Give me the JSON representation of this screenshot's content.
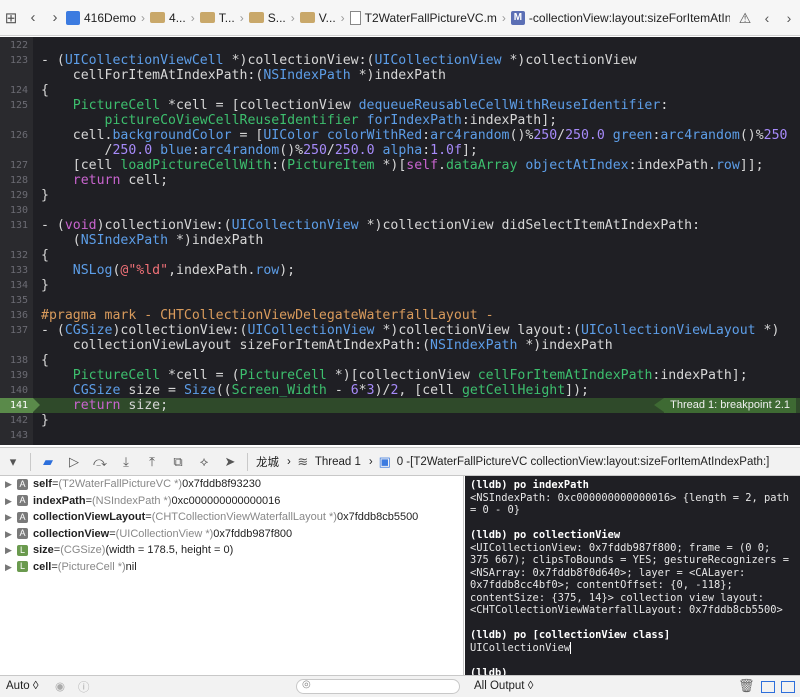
{
  "jumpbar": {
    "items": [
      "416Demo",
      "4...",
      "T...",
      "S...",
      "V...",
      "T2WaterFallPictureVC.m",
      "-collectionView:layout:sizeForItemAtIndexPath:"
    ]
  },
  "editor": {
    "lines": [
      {
        "n": "122",
        "html": ""
      },
      {
        "n": "123",
        "html": "<span class=\"p\">- (</span><span class=\"t\">UICollectionViewCell</span><span class=\"p\"> *)collectionView:(</span><span class=\"t\">UICollectionView</span><span class=\"p\"> *)collectionView</span>"
      },
      {
        "n": "",
        "html": "<span class=\"p\">    cellForItemAtIndexPath:(</span><span class=\"t\">NSIndexPath</span><span class=\"p\"> *)indexPath</span>"
      },
      {
        "n": "124",
        "html": "<span class=\"p\">{</span>"
      },
      {
        "n": "125",
        "html": "<span class=\"p\">    </span><span class=\"g\">PictureCell</span><span class=\"p\"> *cell = [collectionView </span><span class=\"m\">dequeueReusableCellWithReuseIdentifier</span><span class=\"p\">:</span>"
      },
      {
        "n": "",
        "html": "<span class=\"p\">        </span><span class=\"g\">pictureCoViewCellReuseIdentifier</span><span class=\"p\"> </span><span class=\"m\">forIndexPath</span><span class=\"p\">:indexPath];</span>"
      },
      {
        "n": "126",
        "html": "<span class=\"p\">    cell.</span><span class=\"m\">backgroundColor</span><span class=\"p\"> = [</span><span class=\"t\">UIColor</span><span class=\"p\"> </span><span class=\"m\">colorWithRed</span><span class=\"p\">:</span><span class=\"m\">arc4random</span><span class=\"p\">()%</span><span class=\"n\">250</span><span class=\"p\">/</span><span class=\"n\">250.0</span><span class=\"p\"> </span><span class=\"m\">green</span><span class=\"p\">:</span><span class=\"m\">arc4random</span><span class=\"p\">()%</span><span class=\"n\">250</span>"
      },
      {
        "n": "",
        "html": "<span class=\"p\">        /</span><span class=\"n\">250.0</span><span class=\"p\"> </span><span class=\"m\">blue</span><span class=\"p\">:</span><span class=\"m\">arc4random</span><span class=\"p\">()%</span><span class=\"n\">250</span><span class=\"p\">/</span><span class=\"n\">250.0</span><span class=\"p\"> </span><span class=\"m\">alpha</span><span class=\"p\">:</span><span class=\"n\">1.0f</span><span class=\"p\">];</span>"
      },
      {
        "n": "127",
        "html": "<span class=\"p\">    [cell </span><span class=\"g\">loadPictureCellWith</span><span class=\"p\">:(</span><span class=\"g\">PictureItem</span><span class=\"p\"> *)[</span><span class=\"k\">self</span><span class=\"p\">.</span><span class=\"g\">dataArray</span><span class=\"p\"> </span><span class=\"m\">objectAtIndex</span><span class=\"p\">:indexPath.</span><span class=\"m\">row</span><span class=\"p\">]];</span>"
      },
      {
        "n": "128",
        "html": "<span class=\"p\">    </span><span class=\"k\">return</span><span class=\"p\"> cell;</span>"
      },
      {
        "n": "129",
        "html": "<span class=\"p\">}</span>"
      },
      {
        "n": "130",
        "html": ""
      },
      {
        "n": "131",
        "html": "<span class=\"p\">- (</span><span class=\"k\">void</span><span class=\"p\">)collectionView:(</span><span class=\"t\">UICollectionView</span><span class=\"p\"> *)collectionView didSelectItemAtIndexPath:</span>"
      },
      {
        "n": "",
        "html": "<span class=\"p\">    (</span><span class=\"t\">NSIndexPath</span><span class=\"p\"> *)indexPath</span>"
      },
      {
        "n": "132",
        "html": "<span class=\"p\">{</span>"
      },
      {
        "n": "133",
        "html": "<span class=\"p\">    </span><span class=\"m\">NSLog</span><span class=\"p\">(</span><span class=\"s\">@\"%ld\"</span><span class=\"p\">,indexPath.</span><span class=\"m\">row</span><span class=\"p\">);</span>"
      },
      {
        "n": "134",
        "html": "<span class=\"p\">}</span>"
      },
      {
        "n": "135",
        "html": ""
      },
      {
        "n": "136",
        "html": "<span class=\"pr\">#pragma mark - CHTCollectionViewDelegateWaterfallLayout -</span>"
      },
      {
        "n": "137",
        "html": "<span class=\"p\">- (</span><span class=\"t\">CGSize</span><span class=\"p\">)collectionView:(</span><span class=\"t\">UICollectionView</span><span class=\"p\"> *)collectionView layout:(</span><span class=\"t\">UICollectionViewLayout</span><span class=\"p\"> *)</span>"
      },
      {
        "n": "",
        "html": "<span class=\"p\">    collectionViewLayout sizeForItemAtIndexPath:(</span><span class=\"t\">NSIndexPath</span><span class=\"p\"> *)indexPath</span>"
      },
      {
        "n": "138",
        "html": "<span class=\"p\">{</span>"
      },
      {
        "n": "139",
        "html": "<span class=\"p\">    </span><span class=\"g\">PictureCell</span><span class=\"p\"> *cell = (</span><span class=\"g\">PictureCell</span><span class=\"p\"> *)[collectionView </span><span class=\"g\">cellForItemAtIndexPath</span><span class=\"p\">:indexPath];</span>"
      },
      {
        "n": "140",
        "html": "<span class=\"p\">    </span><span class=\"t\">CGSize</span><span class=\"p\"> size = </span><span class=\"t\">Size</span><span class=\"p\">((</span><span class=\"g\">Screen_Width</span><span class=\"p\"> - </span><span class=\"n\">6</span><span class=\"p\">*</span><span class=\"n\">3</span><span class=\"p\">)/</span><span class=\"n\">2</span><span class=\"p\">, [cell </span><span class=\"g\">getCellHeight</span><span class=\"p\">]);</span>"
      },
      {
        "n": "141",
        "html": "<span class=\"p\">    </span><span class=\"k\">return</span><span class=\"p\"> size;</span>",
        "breakpoint": true
      },
      {
        "n": "142",
        "html": "<span class=\"p\">}</span>"
      },
      {
        "n": "143",
        "html": ""
      }
    ],
    "breakpoint_label": "Thread 1: breakpoint 2.1"
  },
  "debugbar": {
    "process": "龙城",
    "thread": "Thread 1",
    "frame": "0 -[T2WaterFallPictureVC collectionView:layout:sizeForItemAtIndexPath:]"
  },
  "variables": [
    {
      "badge": "A",
      "expandable": true,
      "name": "self",
      "type": "(T2WaterFallPictureVC *)",
      "value": "0x7fddb8f93230"
    },
    {
      "badge": "A",
      "expandable": true,
      "name": "indexPath",
      "type": "(NSIndexPath *)",
      "value": "0xc000000000000016"
    },
    {
      "badge": "A",
      "expandable": true,
      "name": "collectionViewLayout",
      "type": "(CHTCollectionViewWaterfallLayout *)",
      "value": "0x7fddb8cb5500"
    },
    {
      "badge": "A",
      "expandable": true,
      "name": "collectionView",
      "type": "(UICollectionView *)",
      "value": "0x7fddb987f800"
    },
    {
      "badge": "L",
      "expandable": true,
      "name": "size",
      "type": "(CGSize)",
      "value": "(width = 178.5, height = 0)"
    },
    {
      "badge": "L",
      "expandable": true,
      "name": "cell",
      "type": "(PictureCell *)",
      "value": "nil"
    }
  ],
  "console": {
    "lines": [
      {
        "prompt": "(lldb) ",
        "text": "po indexPath"
      },
      {
        "text": "<NSIndexPath: 0xc000000000000016> {length = 2, path"
      },
      {
        "text": "= 0 - 0}"
      },
      {
        "text": ""
      },
      {
        "prompt": "(lldb) ",
        "text": "po collectionView"
      },
      {
        "text": "<UICollectionView: 0x7fddb987f800; frame = (0 0;"
      },
      {
        "text": "375 667); clipsToBounds = YES; gestureRecognizers ="
      },
      {
        "text": "<NSArray: 0x7fddb8f0d640>; layer = <CALayer:"
      },
      {
        "text": "0x7fddb8cc4bf0>; contentOffset: {0, -118};"
      },
      {
        "text": "contentSize: {375, 14}> collection view layout:"
      },
      {
        "text": "<CHTCollectionViewWaterfallLayout: 0x7fddb8cb5500>"
      },
      {
        "text": ""
      },
      {
        "prompt": "(lldb) ",
        "text": "po [collectionView class]"
      },
      {
        "text": "UICollectionView"
      },
      {
        "text": ""
      },
      {
        "prompt": "(lldb)",
        "text": ""
      }
    ]
  },
  "bottombar": {
    "auto_label": "Auto ◊",
    "output_label": "All Output ◊",
    "filter_placeholder": ""
  },
  "colors": {
    "editor_bg": "#1f1f24",
    "breakpoint_green": "#3e6a33",
    "accent_blue": "#2d6fdb"
  }
}
